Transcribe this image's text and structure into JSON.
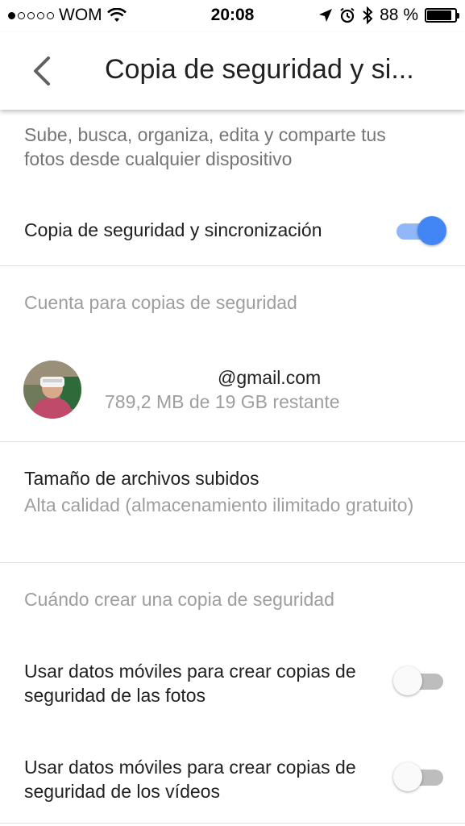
{
  "status_bar": {
    "carrier": "WOM",
    "time": "20:08",
    "battery": "88 %",
    "battery_level": 0.88,
    "icons": [
      "signal-icon",
      "wifi-icon",
      "location-icon",
      "alarm-icon",
      "bluetooth-icon",
      "battery-icon"
    ]
  },
  "app_bar": {
    "title": "Copia de seguridad y si...",
    "back_icon": "back-chevron-icon"
  },
  "description": "Sube, busca, organiza, edita y comparte tus fotos desde cualquier dispositivo",
  "backup_sync": {
    "label": "Copia de seguridad y sincronización",
    "enabled": true
  },
  "account_section": {
    "header": "Cuenta para copias de seguridad",
    "email": "@gmail.com",
    "storage": "789,2 MB de 19 GB restante"
  },
  "upload_size": {
    "title": "Tamaño de archivos subidos",
    "value": "Alta calidad (almacenamiento ilimitado gratuito)"
  },
  "when_section": {
    "header": "Cuándo crear una copia de seguridad",
    "photos_label": "Usar datos móviles para crear copias de seguridad de las fotos",
    "photos_enabled": false,
    "videos_label": "Usar datos móviles para crear copias de seguridad de los vídeos",
    "videos_enabled": false
  },
  "colors": {
    "accent": "#4285f4",
    "accent_track": "#90b8f8",
    "secondary_text": "#9e9e9e"
  }
}
